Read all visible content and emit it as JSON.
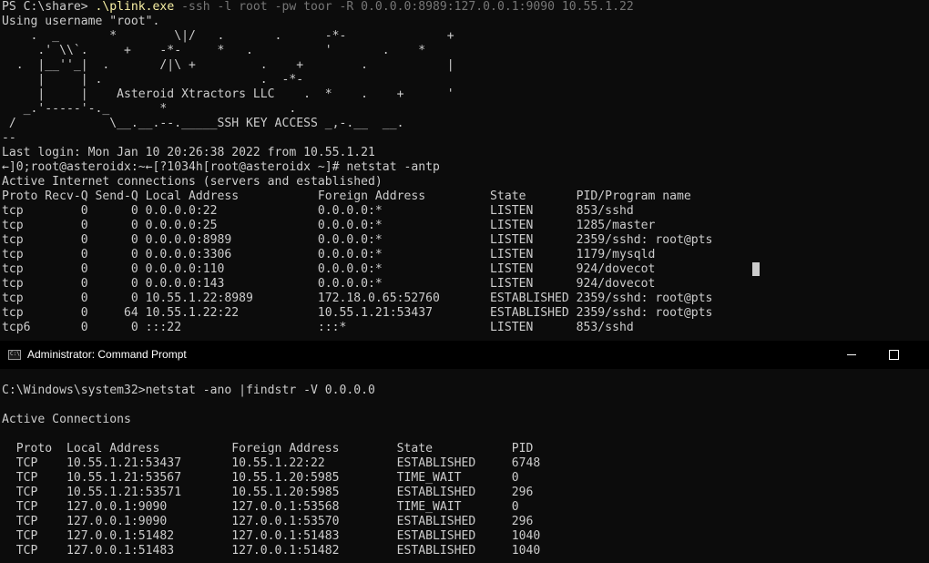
{
  "top_terminal": {
    "prompt": "PS C:\\share> ",
    "command": ".\\plink.exe",
    "args": " -ssh -l root -pw toor -R 0.0.0.0:8989:127.0.0.1:9090 10.55.1.22",
    "lines": [
      "Using username \"root\".",
      "    .  _       *        \\|/   .       .      -*-              +",
      "     .' \\\\`.     +    -*-     *   .          '       .    *",
      "  .  |__''_|  .       /|\\ +         .    +        .           |",
      "     |     | .                      .  -*-",
      "     |     |    Asteroid Xtractors LLC    .  *    .    +      '",
      "   _.'-----'-._       *                 .",
      " /             \\__.__.--._____SSH KEY ACCESS _,-.__  __.",
      "--",
      "Last login: Mon Jan 10 20:26:38 2022 from 10.55.1.21",
      "←]0;root@asteroidx:~←[?1034h[root@asteroidx ~]# netstat -antp",
      "Active Internet connections (servers and established)",
      "Proto Recv-Q Send-Q Local Address           Foreign Address         State       PID/Program name",
      "tcp        0      0 0.0.0.0:22              0.0.0.0:*               LISTEN      853/sshd",
      "tcp        0      0 0.0.0.0:25              0.0.0.0:*               LISTEN      1285/master",
      "tcp        0      0 0.0.0.0:8989            0.0.0.0:*               LISTEN      2359/sshd: root@pts",
      "tcp        0      0 0.0.0.0:3306            0.0.0.0:*               LISTEN      1179/mysqld",
      "tcp        0      0 0.0.0.0:110             0.0.0.0:*               LISTEN      924/dovecot",
      "tcp        0      0 0.0.0.0:143             0.0.0.0:*               LISTEN      924/dovecot",
      "tcp        0      0 10.55.1.22:8989         172.18.0.65:52760       ESTABLISHED 2359/sshd: root@pts",
      "tcp        0     64 10.55.1.22:22           10.55.1.21:53437        ESTABLISHED 2359/sshd: root@pts",
      "tcp6       0      0 :::22                   :::*                    LISTEN      853/sshd"
    ]
  },
  "window": {
    "title": "Administrator: Command Prompt",
    "icon_text": "C:\\"
  },
  "bottom_terminal": {
    "lines": [
      "",
      "C:\\Windows\\system32>netstat -ano |findstr -V 0.0.0.0",
      "",
      "Active Connections",
      "",
      "  Proto  Local Address          Foreign Address        State           PID",
      "  TCP    10.55.1.21:53437       10.55.1.22:22          ESTABLISHED     6748",
      "  TCP    10.55.1.21:53567       10.55.1.20:5985        TIME_WAIT       0",
      "  TCP    10.55.1.21:53571       10.55.1.20:5985        ESTABLISHED     296",
      "  TCP    127.0.0.1:9090         127.0.0.1:53568        TIME_WAIT       0",
      "  TCP    127.0.0.1:9090         127.0.0.1:53570        ESTABLISHED     296",
      "  TCP    127.0.0.1:51482        127.0.0.1:51483        ESTABLISHED     1040",
      "  TCP    127.0.0.1:51483        127.0.0.1:51482        ESTABLISHED     1040"
    ]
  },
  "colors": {
    "terminal_bg": "#0c0c0c",
    "terminal_fg": "#cccccc",
    "ps_command": "#f9f1a5",
    "ps_args": "#767676",
    "titlebar_bg": "#000000"
  }
}
